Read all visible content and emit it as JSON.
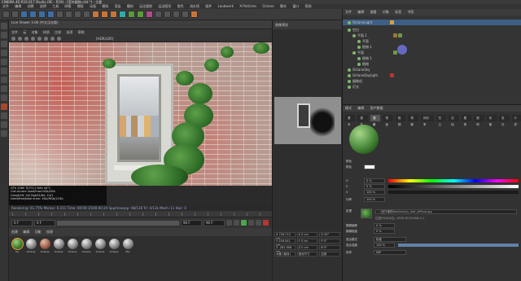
{
  "titlebar": {
    "title": "CINEMA 4D R19.017 Studio (RC - R19) - [室外植物.c4d *] - 主要"
  },
  "menubar": {
    "items": [
      "文件",
      "编辑",
      "创建",
      "选择",
      "工具",
      "网格",
      "捕捉",
      "动画",
      "模拟",
      "渲染",
      "雕刻",
      "运动跟踪",
      "运动图形",
      "角色",
      "流水线",
      "插件",
      "Laubwerk",
      "X-Particles",
      "Octane",
      "脚本",
      "窗口",
      "帮助"
    ]
  },
  "live_viewer": {
    "header": "Live Viewer 3.06 (中文汉化版)",
    "menu": [
      "文件",
      "云",
      "对象",
      "材质",
      "比较",
      "选项",
      "帮助"
    ],
    "tool_label": "[HDR/LDR]",
    "info_lines": [
      "GTX 1080 Ti[TCC]  %64  44°C",
      "Out-of-core used/max:0Gb/4Gb",
      "Grey8/16: 0/0   Rgb32/64: 10/1",
      "Used/free/total vram: 4Gb/9Gb/11Gb"
    ],
    "status": "Rendering: 61.75% Ms/sec: 6.151   Time: 00:00:15/00:00:24   Spp/maxspp: 98/128   Tri: 0/13k   Mesh: 11   Hair: 0"
  },
  "timeline": {
    "start": "0 F",
    "current": "0 F",
    "end": "90 F",
    "end2": "90 F",
    "frame_readout": "0 F"
  },
  "materials": {
    "menu": [
      "创建",
      "编辑",
      "功能",
      "纹理"
    ],
    "items": [
      {
        "label": "Ivy"
      },
      {
        "label": "Octane"
      },
      {
        "label": "Octane"
      },
      {
        "label": "Octane"
      },
      {
        "label": "Octane"
      },
      {
        "label": "Octane"
      },
      {
        "label": "Octane"
      },
      {
        "label": "Octane"
      },
      {
        "label": "Mix"
      }
    ]
  },
  "coords": {
    "rows": [
      [
        "X  726.715 cm",
        "X  0 cm",
        "H  45°"
      ],
      [
        "Y  209.041 cm",
        "Y  0 cm",
        "P  0°"
      ],
      [
        "Z  -281.958 cm",
        "Z  0 cm",
        "B  0°"
      ]
    ],
    "buttons": [
      "对象 (相对)",
      "绝对尺寸",
      "应用"
    ]
  },
  "preview": {
    "header": "图像预览"
  },
  "object_manager": {
    "tabs": [
      "文件",
      "编辑",
      "查看",
      "对象",
      "标签",
      "书签"
    ],
    "rows": [
      {
        "label": "OctaneLight"
      },
      {
        "label": "空白"
      },
      {
        "label": "平面.1"
      },
      {
        "label": "平面"
      },
      {
        "label": "植物.1"
      },
      {
        "label": "平面"
      },
      {
        "label": "植物.1"
      },
      {
        "label": "植物"
      },
      {
        "label": "OctaneSky"
      },
      {
        "label": "OctaneDaylight"
      },
      {
        "label": "摄像机"
      },
      {
        "label": "灯光"
      }
    ]
  },
  "attributes": {
    "tabs": [
      "模式",
      "编辑",
      "用户数据"
    ],
    "subtabs": [
      "基本",
      "属性",
      "漫射",
      "镜面",
      "粗糙",
      "薄膜",
      "折射率",
      "凹凸",
      "法线",
      "置换",
      "透明",
      "传输",
      "发光",
      "介质"
    ],
    "section": "颜色",
    "color_label": "颜色",
    "h_label": "H",
    "h_value": "0 %",
    "s_label": "S",
    "s_value": "0 %",
    "v_label": "V",
    "v_value": "100 %",
    "power_label": "功率",
    "power_value": "100 %",
    "texture_label": "纹理",
    "texture_path": "...\\室外植物\\tex\\tex\\ivy_leaf_diffuse.jpg",
    "texture_info": "位图(RGB,8位), sRGB IEC61966-2.1",
    "blur_label": "模糊偏移",
    "blur_value": "0 %",
    "blur_scale_label": "模糊程度",
    "blur_scale_value": "0 %",
    "mix_label": "混合模式",
    "mix_value": "标准",
    "mix_strength_label": "混合强度",
    "mix_strength_value": "100 %",
    "mix_strength_fraction": 1.0,
    "sampling_label": "采样",
    "sampling_value": "MIP"
  }
}
